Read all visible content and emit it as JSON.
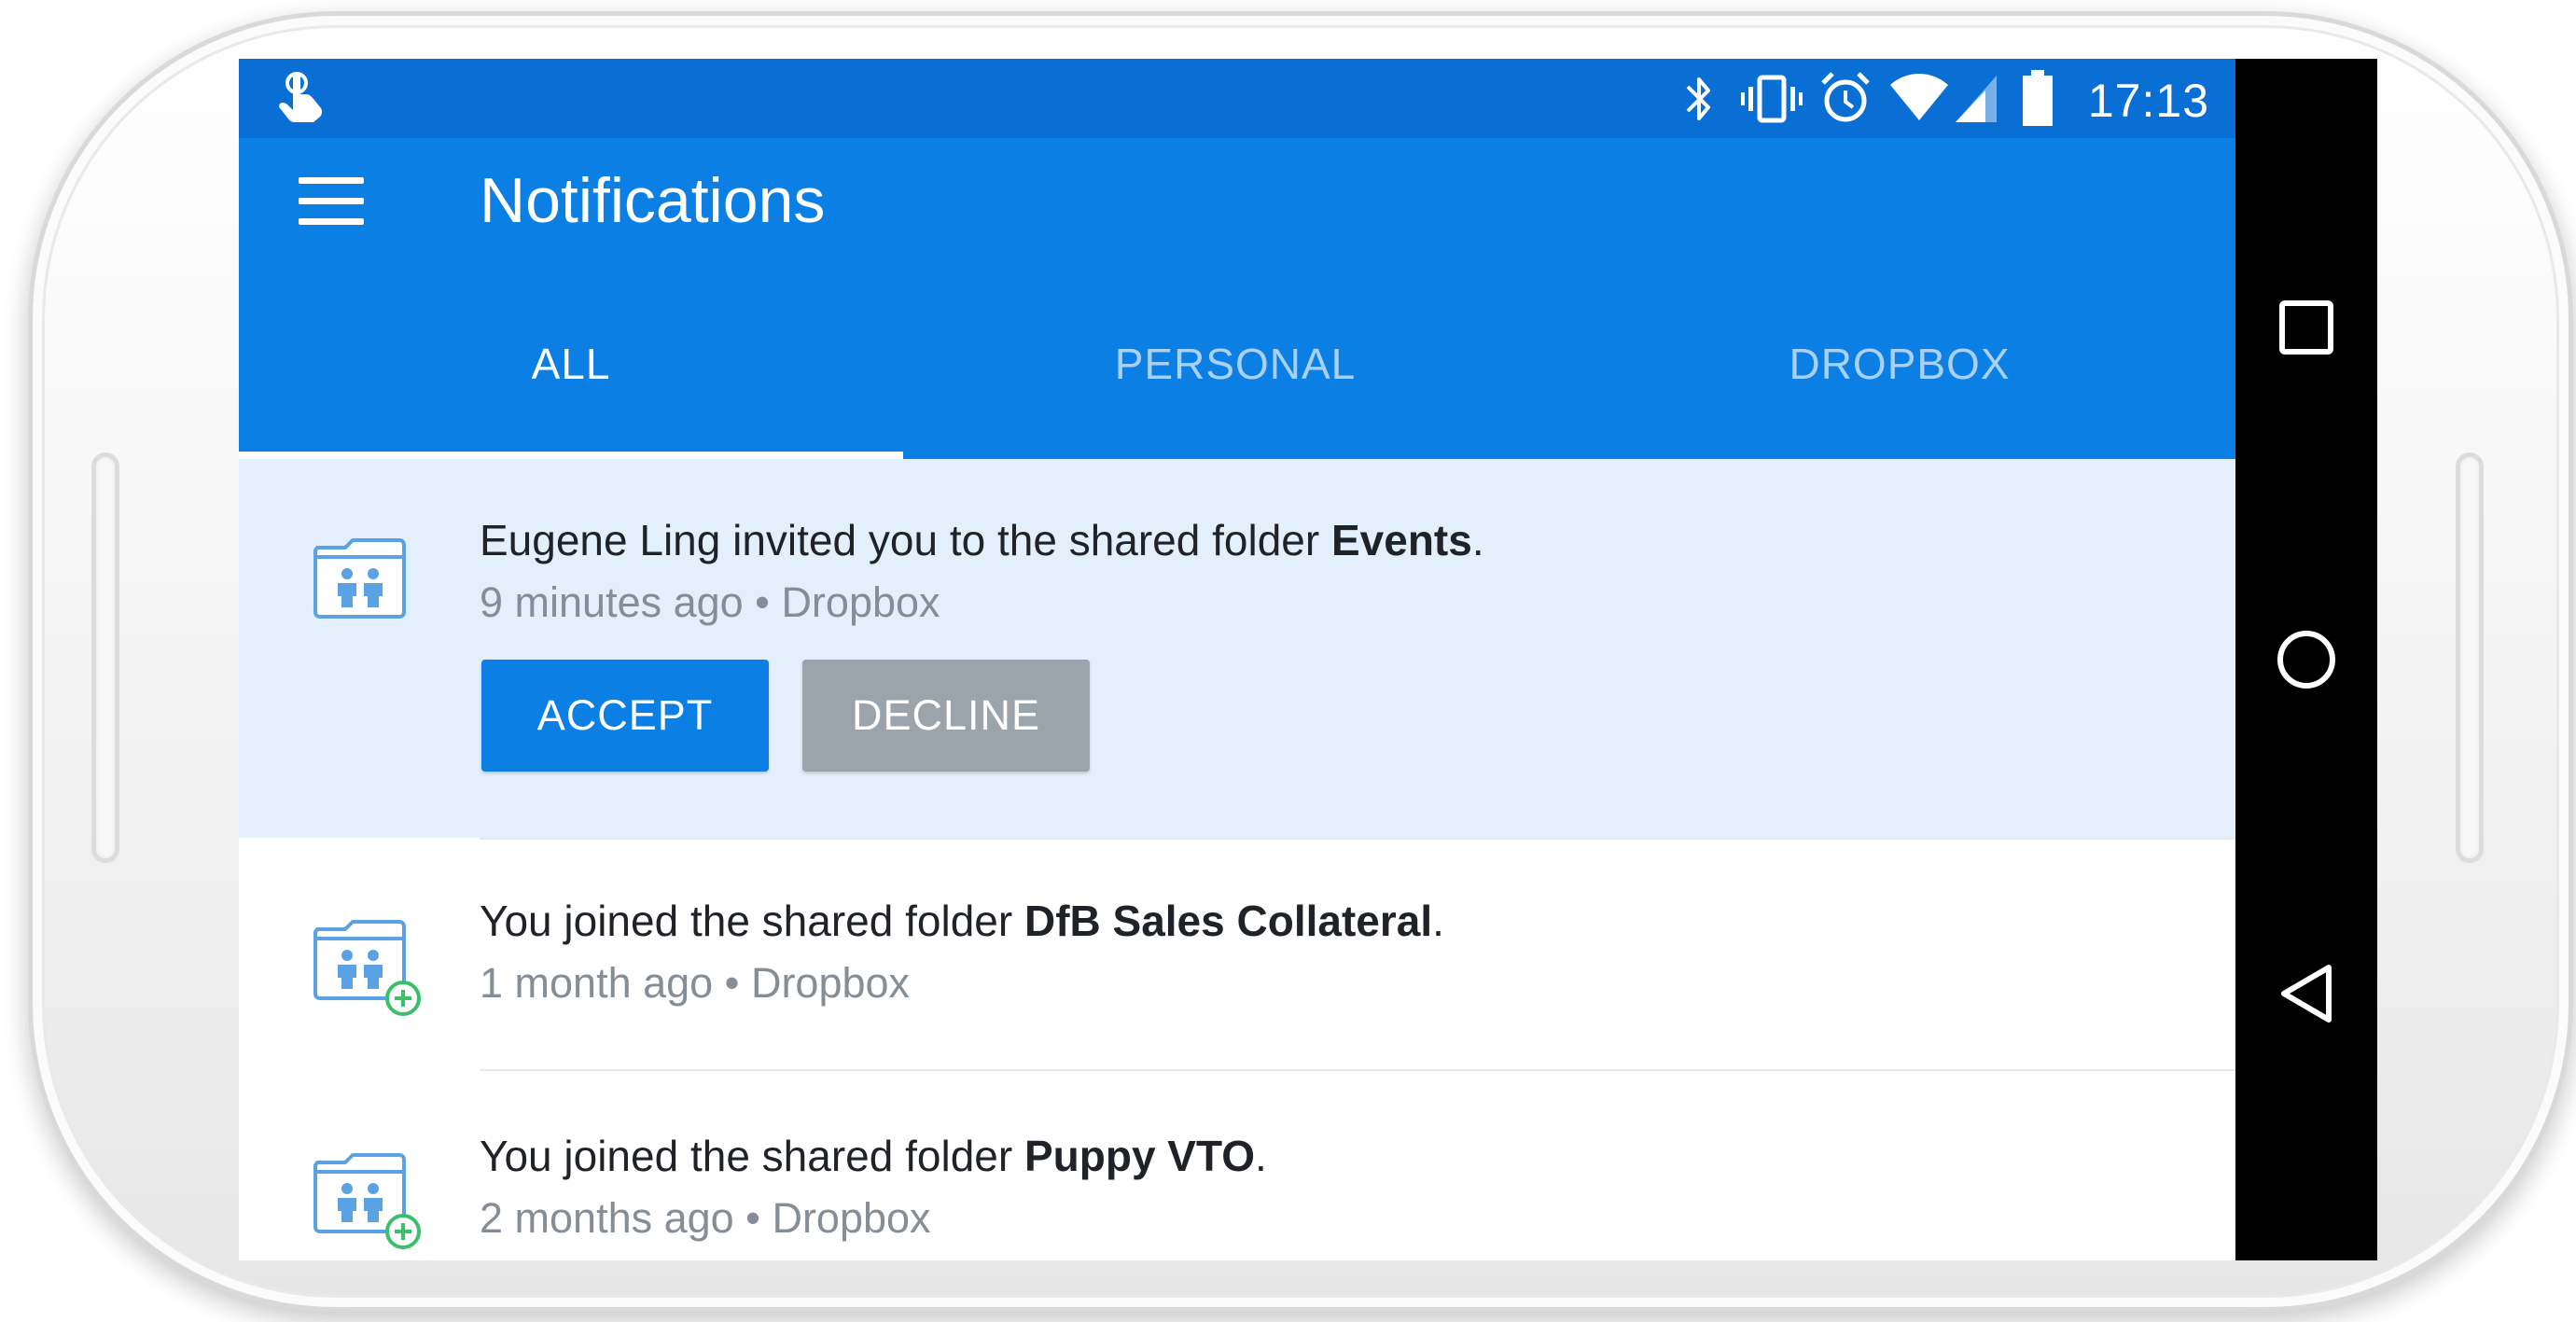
{
  "status_bar": {
    "time": "17:13",
    "icons": [
      "hand-pointer-icon",
      "bluetooth-icon",
      "vibrate-icon",
      "alarm-icon",
      "wifi-icon",
      "cell-signal-icon",
      "battery-icon"
    ]
  },
  "app_bar": {
    "title": "Notifications",
    "menu_icon": "hamburger-menu-icon"
  },
  "tabs": [
    {
      "label": "ALL",
      "selected": true
    },
    {
      "label": "PERSONAL",
      "selected": false
    },
    {
      "label": "DROPBOX",
      "selected": false
    }
  ],
  "notifications": [
    {
      "icon": "shared-folder-icon",
      "text_before": "Eugene Ling invited you to the shared folder ",
      "bold": "Events",
      "text_after": ".",
      "meta": "9 minutes ago • Dropbox",
      "highlighted": true,
      "actions": {
        "accept": "ACCEPT",
        "decline": "DECLINE"
      }
    },
    {
      "icon": "shared-folder-joined-icon",
      "text_before": "You joined the shared folder ",
      "bold": "DfB Sales Collateral",
      "text_after": ".",
      "meta": "1 month ago • Dropbox",
      "highlighted": false
    },
    {
      "icon": "shared-folder-joined-icon",
      "text_before": "You joined the shared folder ",
      "bold": "Puppy VTO",
      "text_after": ".",
      "meta": "2 months ago • Dropbox",
      "highlighted": false
    }
  ],
  "nav_bar": {
    "buttons": [
      "recents-square-icon",
      "home-circle-icon",
      "back-triangle-icon"
    ]
  },
  "colors": {
    "status_bar": "#0a6fd5",
    "app_bar": "#0b7fe3",
    "highlight_row": "#e3f0fb",
    "accept_button": "#0b7fe3",
    "decline_button": "#9ba3ab",
    "tab_inactive": "#a9d1f6"
  }
}
